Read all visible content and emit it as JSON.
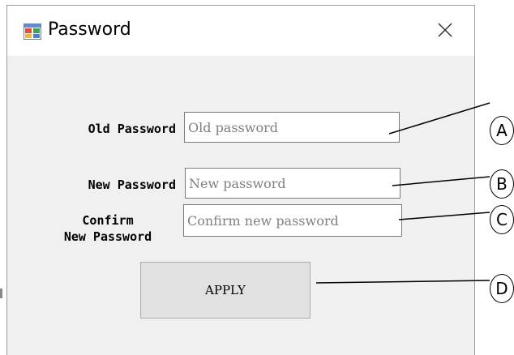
{
  "window": {
    "title": "Password",
    "icon": "app-window-icon",
    "close_icon": "close-icon"
  },
  "form": {
    "old_password": {
      "label": "Old Password",
      "placeholder": "Old password",
      "value": ""
    },
    "new_password": {
      "label": "New Password",
      "placeholder": "New password",
      "value": ""
    },
    "confirm_password": {
      "label_line1": "Confirm",
      "label_line2": "New Password",
      "placeholder": "Confirm new password",
      "value": ""
    },
    "apply_label": "APPLY"
  },
  "callouts": [
    "A",
    "B",
    "C",
    "D"
  ]
}
